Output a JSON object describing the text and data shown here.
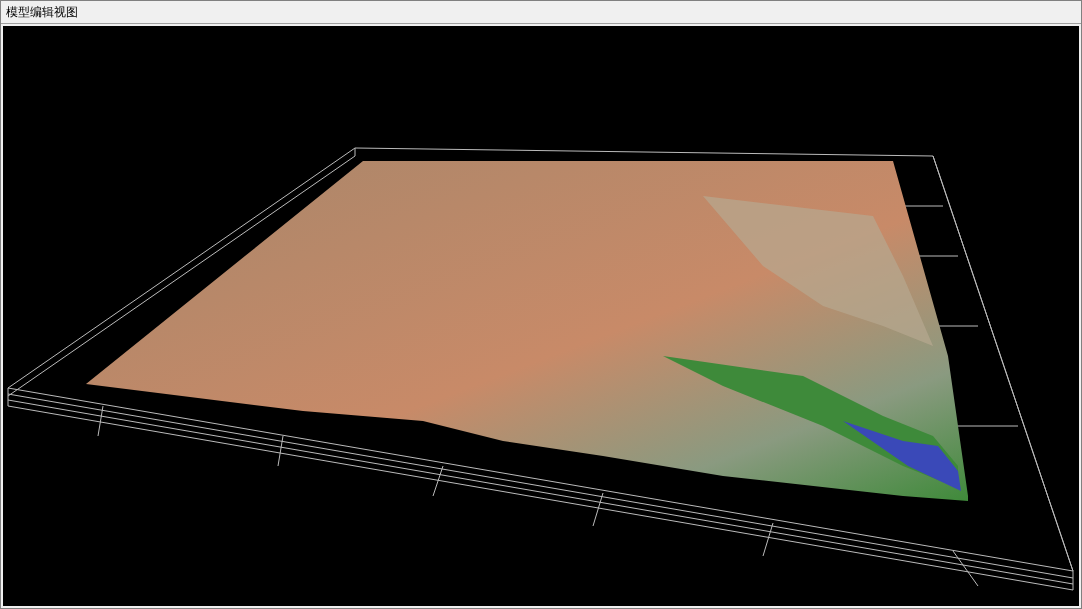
{
  "window": {
    "title": "模型编辑视图"
  }
}
